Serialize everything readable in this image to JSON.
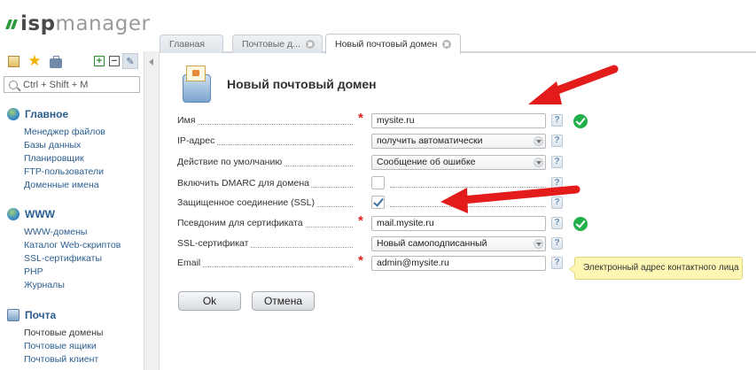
{
  "logo": {
    "part1": "isp",
    "part2": "manager"
  },
  "search": {
    "placeholder": "Ctrl + Shift + M"
  },
  "sidebar": {
    "sections": [
      {
        "title": "Главное",
        "icon": "globe-icon",
        "items": [
          "Менеджер файлов",
          "Базы данных",
          "Планировщик",
          "FTP-пользователи",
          "Доменные имена"
        ]
      },
      {
        "title": "WWW",
        "icon": "globe-icon",
        "items": [
          "WWW-домены",
          "Каталог Web-скриптов",
          "SSL-сертификаты",
          "PHP",
          "Журналы"
        ]
      },
      {
        "title": "Почта",
        "icon": "mail-icon",
        "items": [
          "Почтовые домены",
          "Почтовые ящики",
          "Почтовый клиент"
        ]
      }
    ]
  },
  "tabs": [
    {
      "label": "Главная",
      "closable": false
    },
    {
      "label": "Почтовые д...",
      "closable": true
    },
    {
      "label": "Новый почтовый домен",
      "closable": true
    }
  ],
  "form": {
    "title": "Новый почтовый домен",
    "fields": [
      {
        "label": "Имя",
        "required": true,
        "type": "text",
        "value": "mysite.ru",
        "valid": true
      },
      {
        "label": "IP-адрес",
        "required": false,
        "type": "select",
        "value": "получить автоматически",
        "valid": false
      },
      {
        "label": "Действие по умолчанию",
        "required": false,
        "type": "select",
        "value": "Сообщение об ошибке",
        "valid": false
      },
      {
        "label": "Включить DMARC для домена",
        "required": false,
        "type": "checkbox",
        "checked": false
      },
      {
        "label": "Защищенное соединение (SSL)",
        "required": false,
        "type": "checkbox",
        "checked": true
      },
      {
        "label": "Псевдоним для сертификата",
        "required": true,
        "type": "text",
        "value": "mail.mysite.ru",
        "valid": true
      },
      {
        "label": "SSL-сертификат",
        "required": false,
        "type": "select",
        "value": "Новый самоподписанный",
        "valid": false
      },
      {
        "label": "Email",
        "required": true,
        "type": "text",
        "value": "admin@mysite.ru",
        "valid": false
      }
    ],
    "help_glyph": "?",
    "required_glyph": "*",
    "tooltip": "Электронный адрес контактного лица",
    "ok_label": "Ok",
    "cancel_label": "Отмена"
  },
  "colors": {
    "accent": "#2a5d8f",
    "required": "#e02020",
    "valid": "#22b04a",
    "arrow": "#e31b1b",
    "tooltip_bg": "#fdf7b3"
  }
}
